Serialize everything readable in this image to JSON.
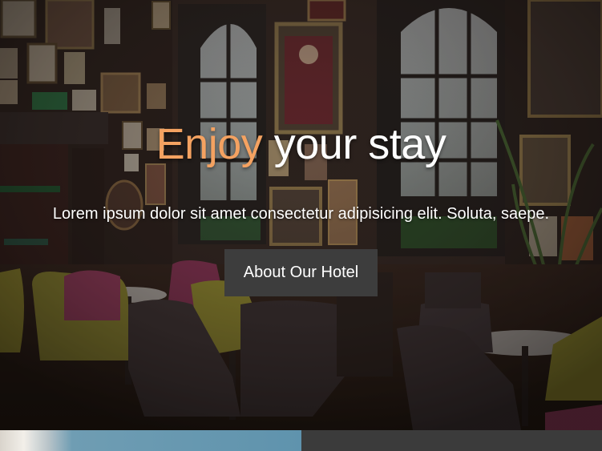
{
  "hero": {
    "title_accent": "Enjoy",
    "title_rest": "your stay",
    "subtitle": "Lorem ipsum dolor sit amet consectetur adipisicing elit. Soluta, saepe.",
    "button_label": "About Our Hotel",
    "background": "hotel-lounge-photo"
  },
  "colors": {
    "accent": "#f4a261",
    "button_bg": "#3d3d3d",
    "text": "#ffffff"
  }
}
